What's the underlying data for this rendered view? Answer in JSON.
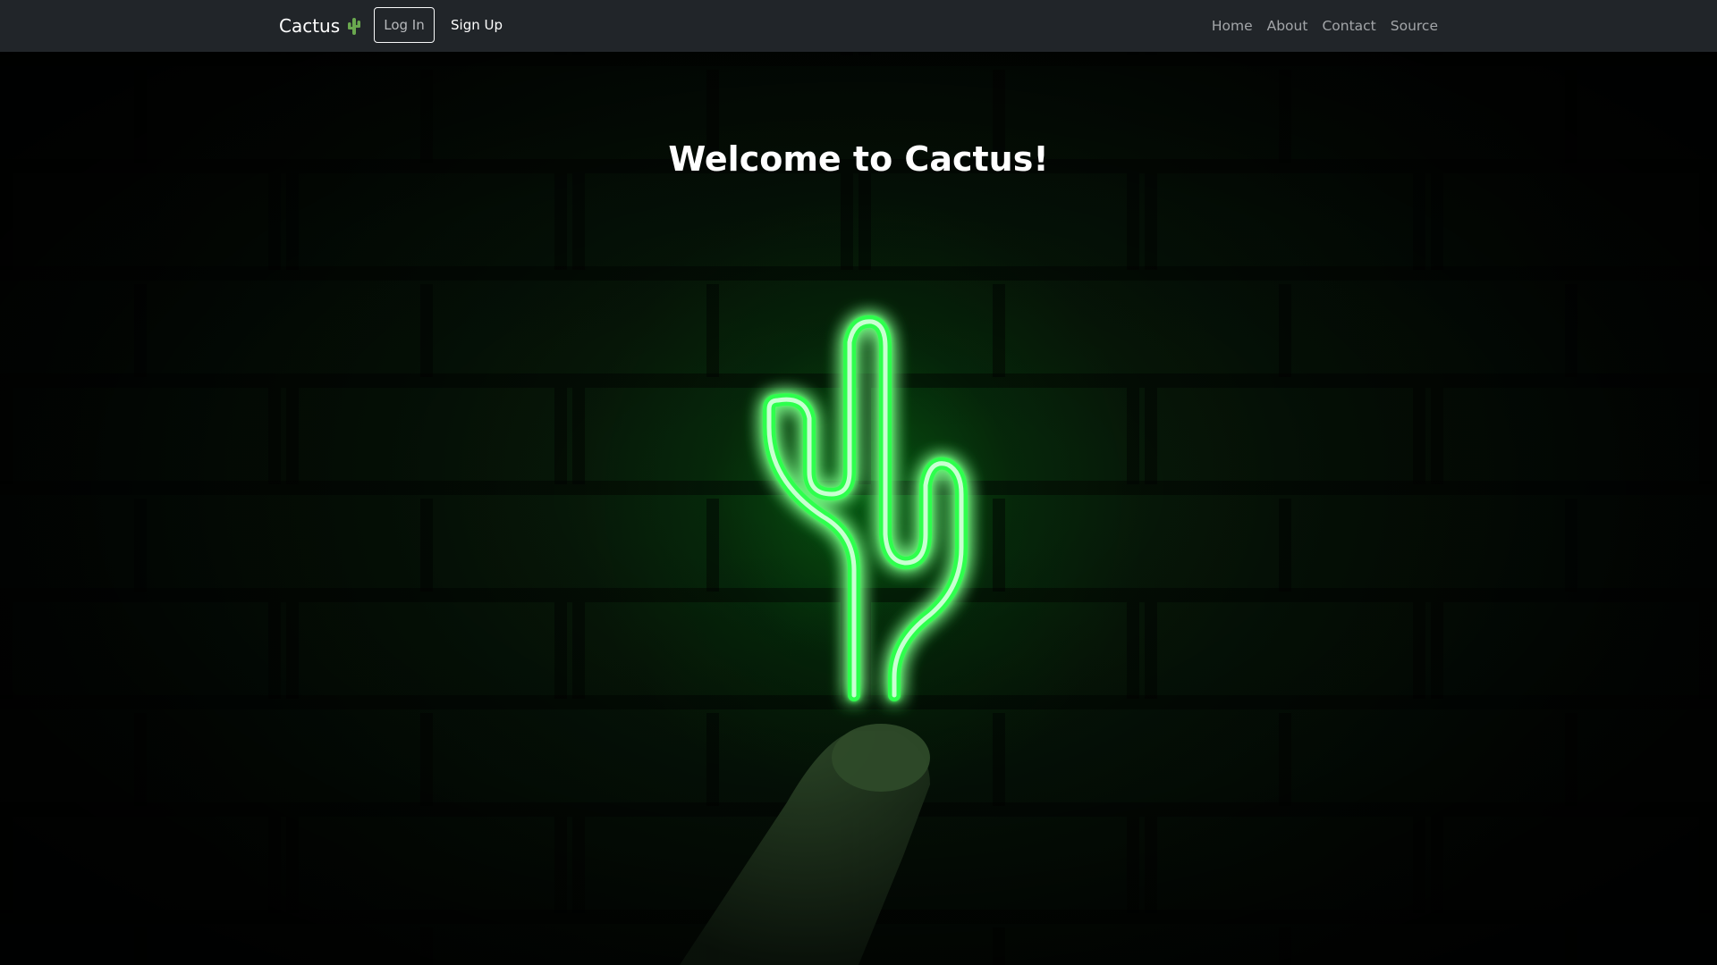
{
  "navbar": {
    "brand_label": "Cactus",
    "brand_icon": "cactus-icon",
    "login_label": "Log In",
    "signup_label": "Sign Up",
    "links": [
      "Home",
      "About",
      "Contact",
      "Source"
    ]
  },
  "hero": {
    "title": "Welcome to Cactus!",
    "background_image": "neon green cactus sign held against dark brick wall"
  },
  "colors": {
    "navbar_bg": "#212529",
    "neon_green": "#39ff5a",
    "text_white": "#ffffff",
    "nav_link": "#a3a6a9"
  }
}
